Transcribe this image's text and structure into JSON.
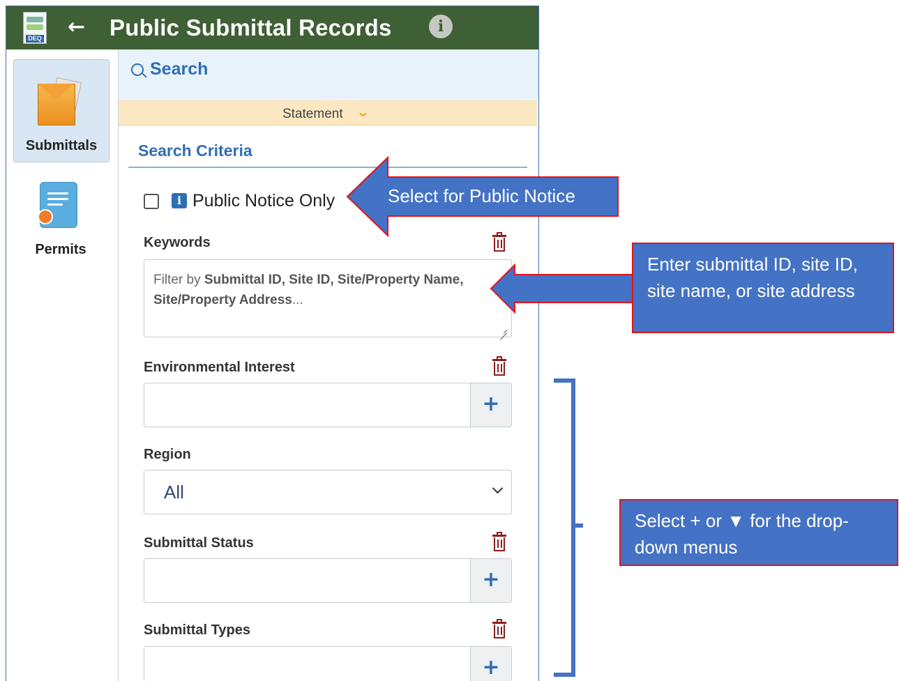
{
  "header": {
    "title": "Public Submittal Records",
    "logo_text": "DEQ",
    "back_icon": "arrow-left-icon",
    "info_icon": "info-icon"
  },
  "sidebar": {
    "items": [
      {
        "label": "Submittals",
        "icon": "submittals-envelope-icon",
        "active": true
      },
      {
        "label": "Permits",
        "icon": "permit-certificate-icon",
        "active": false
      }
    ]
  },
  "search": {
    "title": "Search",
    "statement_label": "Statement",
    "criteria_title": "Search Criteria",
    "public_notice": {
      "label": "Public Notice Only",
      "checked": false
    },
    "keywords": {
      "label": "Keywords",
      "placeholder_prefix": "Filter by ",
      "placeholder_bold": "Submittal ID, Site ID, Site/Property Name, Site/Property Address",
      "placeholder_suffix": "..."
    },
    "environmental_interest": {
      "label": "Environmental Interest",
      "value": "",
      "add_label": "+"
    },
    "region": {
      "label": "Region",
      "value": "All"
    },
    "submittal_status": {
      "label": "Submittal Status",
      "value": "",
      "add_label": "+"
    },
    "submittal_types": {
      "label": "Submittal Types",
      "value": "",
      "add_label": "+"
    }
  },
  "annotations": {
    "public_notice": "Select for Public Notice",
    "keywords": "Enter submittal ID, site ID, site name, or site address",
    "dropdowns": "Select + or ▼ for the drop-down menus"
  },
  "colors": {
    "header_bg": "#3f5f34",
    "accent_blue": "#2f6fb3",
    "callout_bg": "#4472c4",
    "callout_border": "#e0141e",
    "trash_red": "#8b1d1d",
    "statement_bg": "#fbe8c2"
  }
}
